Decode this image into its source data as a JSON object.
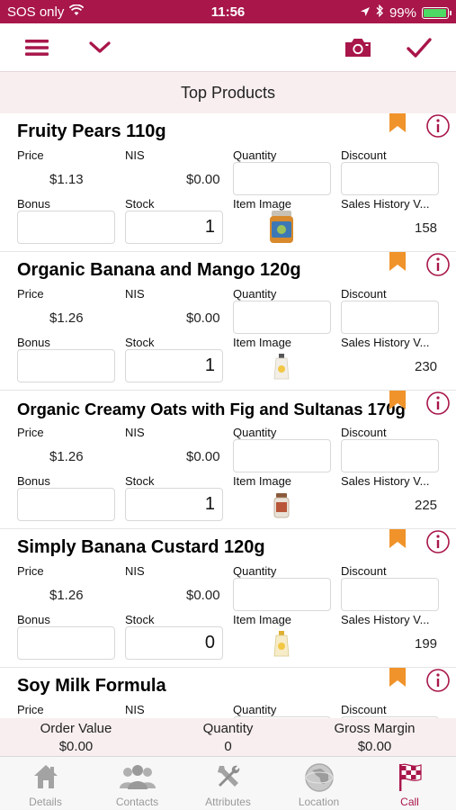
{
  "status_bar": {
    "carrier": "SOS only",
    "time": "11:56",
    "battery_percent": "99%",
    "battery_level": 0.99,
    "icons": [
      "wifi-icon",
      "location-arrow-icon",
      "bluetooth-icon",
      "battery-icon"
    ]
  },
  "toolbar": {
    "icons": [
      "menu-icon",
      "chevron-down-icon",
      "camera-icon",
      "checkmark-icon"
    ],
    "accent_color": "#a8164a"
  },
  "header": {
    "title": "Top Products"
  },
  "labels": {
    "price": "Price",
    "nis": "NIS",
    "quantity": "Quantity",
    "discount": "Discount",
    "bonus": "Bonus",
    "stock": "Stock",
    "item_image": "Item Image",
    "sales_history": "Sales History V..."
  },
  "products": [
    {
      "name": "Fruity Pears 110g",
      "price": "$1.13",
      "nis": "$0.00",
      "stock": "1",
      "sales_history": "158",
      "image_icon": "baby-food-jar-icon"
    },
    {
      "name": "Organic Banana and Mango 120g",
      "price": "$1.26",
      "nis": "$0.00",
      "stock": "1",
      "sales_history": "230",
      "image_icon": "baby-food-pouch-icon"
    },
    {
      "name": "Organic Creamy Oats with Fig and Sultanas 170g",
      "price": "$1.26",
      "nis": "$0.00",
      "stock": "1",
      "sales_history": "225",
      "image_icon": "baby-food-jar-icon"
    },
    {
      "name": "Simply Banana Custard 120g",
      "price": "$1.26",
      "nis": "$0.00",
      "stock": "0",
      "sales_history": "199",
      "image_icon": "baby-food-pouch-icon"
    },
    {
      "name": "Soy Milk Formula"
    }
  ],
  "summary": {
    "order_value_label": "Order Value",
    "order_value": "$0.00",
    "quantity_label": "Quantity",
    "quantity": "0",
    "gross_margin_label": "Gross Margin",
    "gross_margin": "$0.00"
  },
  "tabs": [
    {
      "label": "Details",
      "icon": "house-icon"
    },
    {
      "label": "Contacts",
      "icon": "people-icon"
    },
    {
      "label": "Attributes",
      "icon": "tools-icon"
    },
    {
      "label": "Location",
      "icon": "globe-icon"
    },
    {
      "label": "Call",
      "icon": "checkered-flag-icon",
      "active": true
    }
  ]
}
